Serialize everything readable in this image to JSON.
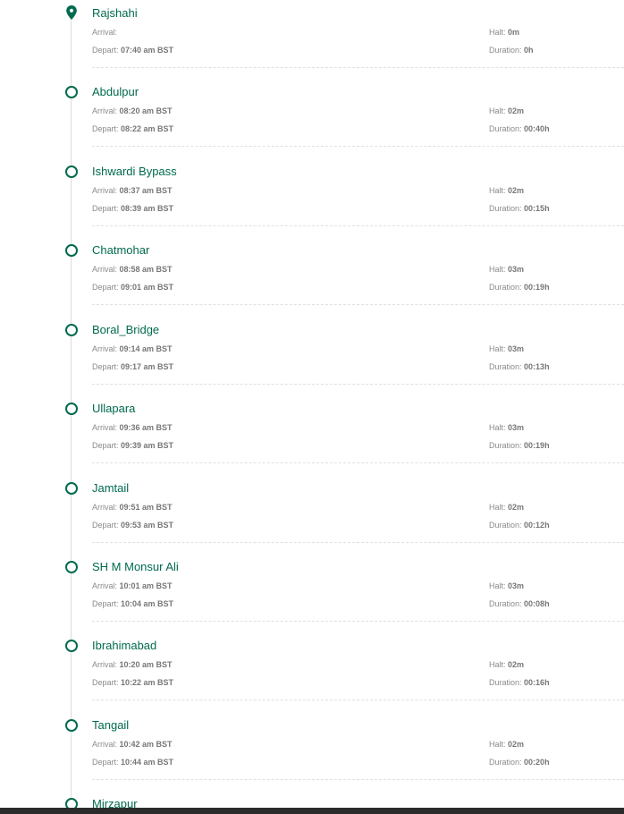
{
  "labels": {
    "arrival": "Arrival:",
    "depart": "Depart:",
    "halt": "Halt:",
    "duration": "Duration:"
  },
  "colors": {
    "accent": "#006a4e",
    "line": "#dcdcdc",
    "muted": "#8a8a8a"
  },
  "stops": [
    {
      "name": "Rajshahi",
      "arrival": "",
      "depart": "07:40 am BST",
      "halt": "0m",
      "duration": "0h",
      "icon": "location-pin-icon"
    },
    {
      "name": "Abdulpur",
      "arrival": "08:20 am BST",
      "depart": "08:22 am BST",
      "halt": "02m",
      "duration": "00:40h"
    },
    {
      "name": "Ishwardi Bypass",
      "arrival": "08:37 am BST",
      "depart": "08:39 am BST",
      "halt": "02m",
      "duration": "00:15h"
    },
    {
      "name": "Chatmohar",
      "arrival": "08:58 am BST",
      "depart": "09:01 am BST",
      "halt": "03m",
      "duration": "00:19h"
    },
    {
      "name": "Boral_Bridge",
      "arrival": "09:14 am BST",
      "depart": "09:17 am BST",
      "halt": "03m",
      "duration": "00:13h"
    },
    {
      "name": "Ullapara",
      "arrival": "09:36 am BST",
      "depart": "09:39 am BST",
      "halt": "03m",
      "duration": "00:19h"
    },
    {
      "name": "Jamtail",
      "arrival": "09:51 am BST",
      "depart": "09:53 am BST",
      "halt": "02m",
      "duration": "00:12h"
    },
    {
      "name": "SH M Monsur Ali",
      "arrival": "10:01 am BST",
      "depart": "10:04 am BST",
      "halt": "03m",
      "duration": "00:08h"
    },
    {
      "name": "Ibrahimabad",
      "arrival": "10:20 am BST",
      "depart": "10:22 am BST",
      "halt": "02m",
      "duration": "00:16h"
    },
    {
      "name": "Tangail",
      "arrival": "10:42 am BST",
      "depart": "10:44 am BST",
      "halt": "02m",
      "duration": "00:20h"
    },
    {
      "name": "Mirzapur",
      "arrival": "",
      "depart": "",
      "halt": "",
      "duration": ""
    }
  ]
}
